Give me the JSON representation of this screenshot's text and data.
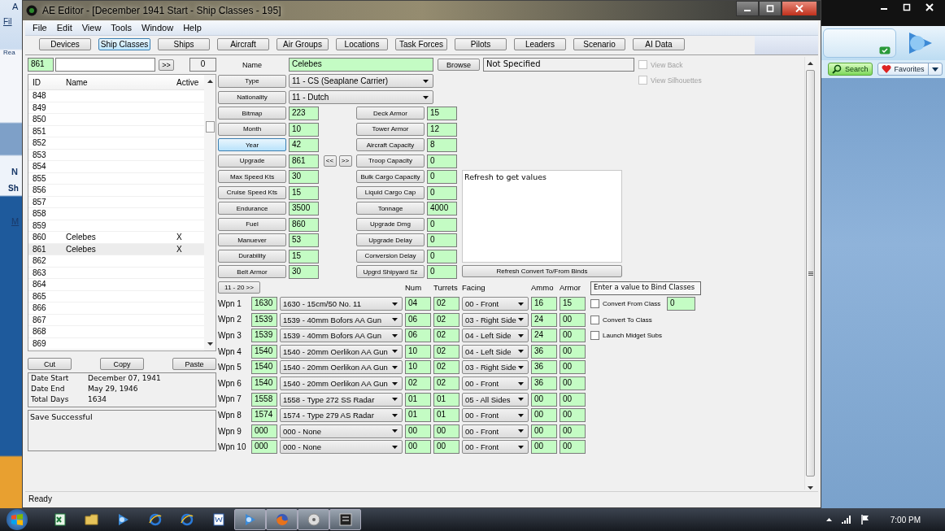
{
  "background_app": {
    "fragments": [
      "A",
      "Fil",
      "Rea",
      "N",
      "Sh",
      "M"
    ]
  },
  "side_app": {
    "buttons": [
      {
        "kind": "search",
        "label": "Search"
      },
      {
        "kind": "favorites",
        "label": "Favorites"
      }
    ]
  },
  "window": {
    "title": "AE Editor - [December 1941 Start - Ship Classes - 195]"
  },
  "menu": [
    "File",
    "Edit",
    "View",
    "Tools",
    "Window",
    "Help"
  ],
  "toolbar": [
    {
      "label": "Devices",
      "selected": false
    },
    {
      "label": "Ship Classes",
      "selected": true
    },
    {
      "label": "Ships",
      "selected": false
    },
    {
      "label": "Aircraft",
      "selected": false
    },
    {
      "label": "Air Groups",
      "selected": false
    },
    {
      "label": "Locations",
      "selected": false
    },
    {
      "label": "Task Forces",
      "selected": false
    },
    {
      "label": "Pilots",
      "selected": false
    },
    {
      "label": "Leaders",
      "selected": false
    },
    {
      "label": "Scenario",
      "selected": false
    },
    {
      "label": "AI Data",
      "selected": false
    }
  ],
  "list_panel": {
    "id_field": "861",
    "go_button": ">>",
    "count": "0",
    "columns": [
      "ID",
      "Name",
      "Active"
    ],
    "rows": [
      {
        "id": "848",
        "selected": false
      },
      {
        "id": "849",
        "selected": false
      },
      {
        "id": "850",
        "selected": false
      },
      {
        "id": "851",
        "selected": false
      },
      {
        "id": "852",
        "selected": false
      },
      {
        "id": "853",
        "selected": false
      },
      {
        "id": "854",
        "selected": false
      },
      {
        "id": "855",
        "selected": false
      },
      {
        "id": "856",
        "selected": false
      },
      {
        "id": "857",
        "selected": false
      },
      {
        "id": "858",
        "selected": false
      },
      {
        "id": "859",
        "selected": false
      },
      {
        "id": "860",
        "name": "Celebes",
        "active": "X",
        "selected": false
      },
      {
        "id": "861",
        "name": "Celebes",
        "active": "X",
        "selected": true
      },
      {
        "id": "862",
        "selected": false
      },
      {
        "id": "863",
        "selected": false
      },
      {
        "id": "864",
        "selected": false
      },
      {
        "id": "865",
        "selected": false
      },
      {
        "id": "866",
        "selected": false
      },
      {
        "id": "867",
        "selected": false
      },
      {
        "id": "868",
        "selected": false
      },
      {
        "id": "869",
        "selected": false
      }
    ],
    "buttons": [
      "Cut",
      "Copy",
      "Paste"
    ],
    "dates": [
      {
        "label": "Date Start",
        "value": "December 07, 1941"
      },
      {
        "label": "Date End",
        "value": "May 29, 1946"
      },
      {
        "label": "Total Days",
        "value": "1634"
      }
    ],
    "message": "Save Successful"
  },
  "form": {
    "name_label": "Name",
    "name": "Celebes",
    "browse_button": "Browse",
    "image_file": "Not Specified",
    "type": {
      "label": "Type",
      "value": "11 - CS (Seaplane Carrier)"
    },
    "nationality": {
      "label": "Nationality",
      "value": "11 - Dutch"
    },
    "view_options": [
      {
        "label": "View Back",
        "checked": false,
        "disabled": true
      },
      {
        "label": "View Silhouettes",
        "checked": false,
        "disabled": true
      }
    ],
    "stats_left": [
      {
        "label": "Bitmap",
        "value": "223",
        "selected": false
      },
      {
        "label": "Month",
        "value": "10",
        "selected": false
      },
      {
        "label": "Year",
        "value": "42",
        "selected": true
      },
      {
        "label": "Upgrade",
        "value": "861",
        "selected": false
      },
      {
        "label": "Max Speed Kts",
        "value": "30",
        "selected": false
      },
      {
        "label": "Cruise Speed Kts",
        "value": "15",
        "selected": false
      },
      {
        "label": "Endurance",
        "value": "3500",
        "selected": false
      },
      {
        "label": "Fuel",
        "value": "860",
        "selected": false
      },
      {
        "label": "Manuever",
        "value": "53",
        "selected": false
      },
      {
        "label": "Durability",
        "value": "15",
        "selected": false
      },
      {
        "label": "Belt Armor",
        "value": "30",
        "selected": false
      }
    ],
    "upgrade_nav": [
      "<<",
      ">>"
    ],
    "stats_right": [
      {
        "label": "Deck Armor",
        "value": "15"
      },
      {
        "label": "Tower Armor",
        "value": "12"
      },
      {
        "label": "Aircraft Capacity",
        "value": "8"
      },
      {
        "label": "Troop Capacity",
        "value": "0"
      },
      {
        "label": "Bulk Cargo Capacity",
        "value": "0"
      },
      {
        "label": "Liquid Cargo Cap",
        "value": "0"
      },
      {
        "label": "Tonnage",
        "value": "4000"
      },
      {
        "label": "Upgrade Dmg",
        "value": "0"
      },
      {
        "label": "Upgrade Delay",
        "value": "0"
      },
      {
        "label": "Conversion Delay",
        "value": "0"
      },
      {
        "label": "Upgrd Shipyard Sz",
        "value": "0"
      }
    ],
    "convert_info": "Refresh to get values",
    "refresh_button": "Refresh Convert To/From Binds"
  },
  "weapons": {
    "page_button": "11 - 20 >>",
    "columns": [
      "Num",
      "Turrets",
      "Facing",
      "Ammo",
      "Armor"
    ],
    "rows": [
      {
        "label": "Wpn 1",
        "id": "1630",
        "device": "1630 - 15cm/50 No. 11",
        "num": "04",
        "turrets": "02",
        "facing": "00 - Front",
        "ammo": "16",
        "armor": "15"
      },
      {
        "label": "Wpn 2",
        "id": "1539",
        "device": "1539 - 40mm Bofors AA Gun",
        "num": "06",
        "turrets": "02",
        "facing": "03 - Right Side",
        "ammo": "24",
        "armor": "00"
      },
      {
        "label": "Wpn 3",
        "id": "1539",
        "device": "1539 - 40mm Bofors AA Gun",
        "num": "06",
        "turrets": "02",
        "facing": "04 - Left Side",
        "ammo": "24",
        "armor": "00"
      },
      {
        "label": "Wpn 4",
        "id": "1540",
        "device": "1540 - 20mm Oerlikon AA Gun",
        "num": "10",
        "turrets": "02",
        "facing": "04 - Left Side",
        "ammo": "36",
        "armor": "00"
      },
      {
        "label": "Wpn 5",
        "id": "1540",
        "device": "1540 - 20mm Oerlikon AA Gun",
        "num": "10",
        "turrets": "02",
        "facing": "03 - Right Side",
        "ammo": "36",
        "armor": "00"
      },
      {
        "label": "Wpn 6",
        "id": "1540",
        "device": "1540 - 20mm Oerlikon AA Gun",
        "num": "02",
        "turrets": "02",
        "facing": "00 - Front",
        "ammo": "36",
        "armor": "00"
      },
      {
        "label": "Wpn 7",
        "id": "1558",
        "device": "1558 - Type 272 SS Radar",
        "num": "01",
        "turrets": "01",
        "facing": "05 - All Sides",
        "ammo": "00",
        "armor": "00"
      },
      {
        "label": "Wpn 8",
        "id": "1574",
        "device": "1574 - Type 279 AS Radar",
        "num": "01",
        "turrets": "01",
        "facing": "00 - Front",
        "ammo": "00",
        "armor": "00"
      },
      {
        "label": "Wpn 9",
        "id": "000",
        "device": "000 - None",
        "num": "00",
        "turrets": "00",
        "facing": "00 - Front",
        "ammo": "00",
        "armor": "00"
      },
      {
        "label": "Wpn 10",
        "id": "000",
        "device": "000 - None",
        "num": "00",
        "turrets": "00",
        "facing": "00 - Front",
        "ammo": "00",
        "armor": "00"
      }
    ]
  },
  "bind": {
    "title": "Enter a value to Bind Classes",
    "value": "0",
    "options": [
      {
        "label": "Convert From Class",
        "checked": false
      },
      {
        "label": "Convert To Class",
        "checked": false
      },
      {
        "label": "Launch Midget Subs",
        "checked": false
      }
    ]
  },
  "status_bar": "Ready",
  "taskbar": {
    "pinned": [
      {
        "kind": "excel",
        "active": false
      },
      {
        "kind": "folder",
        "active": false
      },
      {
        "kind": "media",
        "active": false
      },
      {
        "kind": "browser",
        "active": false
      },
      {
        "kind": "browser",
        "active": false
      },
      {
        "kind": "word",
        "active": false
      },
      {
        "kind": "media",
        "active": true
      },
      {
        "kind": "fox",
        "active": true
      },
      {
        "kind": "disc",
        "active": true
      },
      {
        "kind": "game",
        "active": true
      }
    ],
    "time": "7:00 PM"
  }
}
